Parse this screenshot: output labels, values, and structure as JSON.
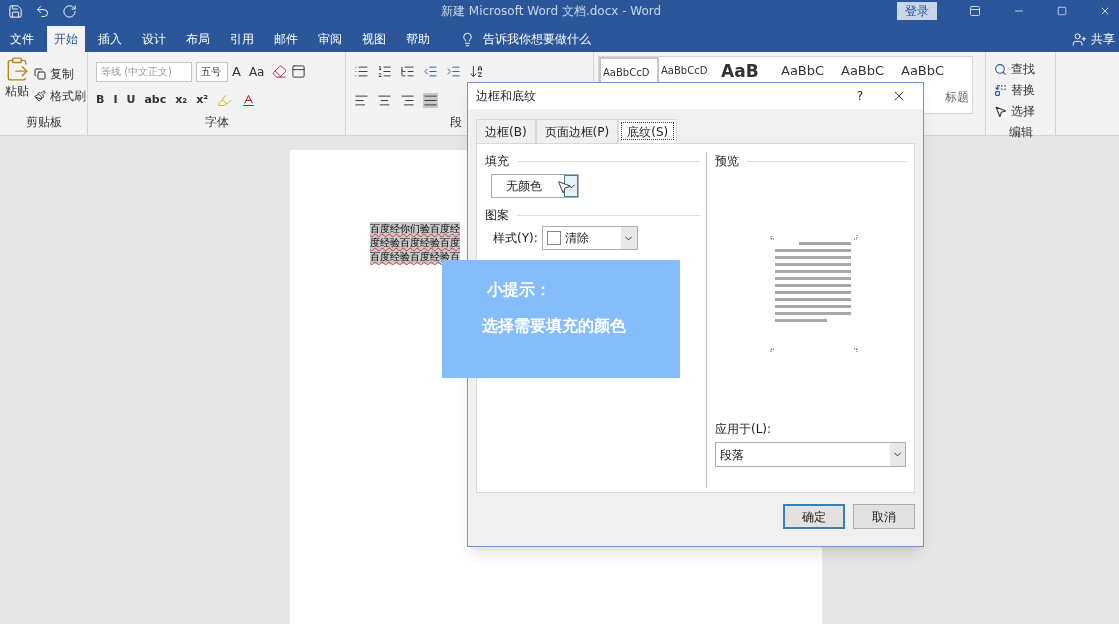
{
  "title_bar": {
    "title": "新建 Microsoft Word 文档.docx  -  Word",
    "login": "登录"
  },
  "ribbon_tabs": [
    {
      "label": "文件",
      "selected": false
    },
    {
      "label": "开始",
      "selected": true
    },
    {
      "label": "插入",
      "selected": false
    },
    {
      "label": "设计",
      "selected": false
    },
    {
      "label": "布局",
      "selected": false
    },
    {
      "label": "引用",
      "selected": false
    },
    {
      "label": "邮件",
      "selected": false
    },
    {
      "label": "审阅",
      "selected": false
    },
    {
      "label": "视图",
      "selected": false
    },
    {
      "label": "帮助",
      "selected": false
    }
  ],
  "tell_me": "告诉我你想要做什么",
  "share": "共享",
  "clipboard": {
    "paste": "粘贴",
    "copy": "复制",
    "format_painter": "格式刷",
    "label": "剪贴板"
  },
  "font": {
    "name": "等线 (中文正文)",
    "size": "五号",
    "grow_button": "A",
    "case_button": "Aa",
    "format_buttons": [
      "B",
      "I",
      "U",
      "abc",
      "x₂",
      "x²"
    ],
    "label": "字体"
  },
  "paragraph": {
    "label": "段"
  },
  "styles": {
    "previews": [
      {
        "text": "AaBbCcD",
        "selected": true
      },
      {
        "text": "AaBbCcD",
        "selected": false
      },
      {
        "text": "AaB",
        "selected": false
      },
      {
        "text": "AaBbC",
        "selected": false
      },
      {
        "text": "AaBbC",
        "selected": false
      },
      {
        "text": "AaBbC",
        "selected": false
      }
    ],
    "caption": "标题"
  },
  "editing": {
    "find": "查找",
    "replace": "替换",
    "select": "选择",
    "label": "编辑"
  },
  "document": {
    "lines": [
      "百度经你们验百度经",
      "度经验百度经验百度",
      "百度经验百度经验百"
    ]
  },
  "dialog": {
    "title": "边框和底纹",
    "help": "?",
    "tabs": [
      {
        "label": "边框(B)",
        "selected": false
      },
      {
        "label": "页面边框(P)",
        "selected": false
      },
      {
        "label": "底纹(S)",
        "selected": true
      }
    ],
    "fill_heading": "填充",
    "fill_value": "无颜色",
    "pattern_heading": "图案",
    "style_label": "样式(Y):",
    "style_value": "清除",
    "preview_heading": "预览",
    "apply_label": "应用于(L):",
    "apply_value": "段落",
    "ok": "确定",
    "cancel": "取消"
  },
  "tip": {
    "title": "小提示：",
    "text": "选择需要填充的颜色"
  }
}
